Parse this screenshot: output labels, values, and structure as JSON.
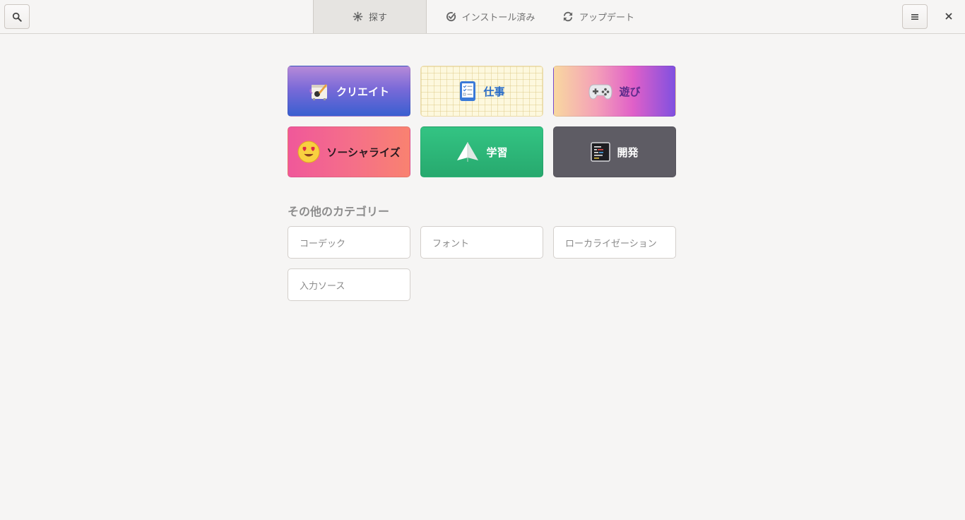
{
  "header": {
    "tabs": [
      {
        "label": "探す",
        "icon": "explore-icon",
        "active": true
      },
      {
        "label": "インストール済み",
        "icon": "check-circle-icon",
        "active": false
      },
      {
        "label": "アップデート",
        "icon": "refresh-icon",
        "active": false
      }
    ]
  },
  "featured_categories": [
    {
      "label": "クリエイト",
      "icon": "paint-canvas-icon"
    },
    {
      "label": "仕事",
      "icon": "checklist-icon"
    },
    {
      "label": "遊び",
      "icon": "gamepad-icon"
    },
    {
      "label": "ソーシャライズ",
      "icon": "heart-eyes-emoji-icon"
    },
    {
      "label": "学習",
      "icon": "paper-plane-icon"
    },
    {
      "label": "開発",
      "icon": "terminal-code-icon"
    }
  ],
  "other_section": {
    "title": "その他のカテゴリー",
    "items": [
      "コーデック",
      "フォント",
      "ローカライゼーション",
      "入力ソース"
    ]
  },
  "colors": {
    "background": "#f6f5f4",
    "work_text": "#2a6cc8",
    "play_text": "#5a2a8a"
  }
}
